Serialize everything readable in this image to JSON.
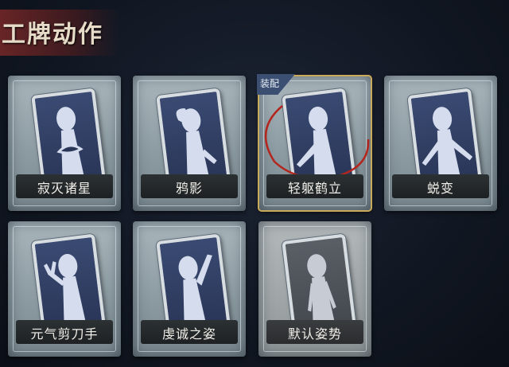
{
  "header": {
    "title": "工牌动作"
  },
  "cards": [
    {
      "label": "寂灭诸星",
      "pose": "hands-at-chest"
    },
    {
      "label": "鸦影",
      "pose": "hand-on-head"
    },
    {
      "label": "轻躯鹤立",
      "pose": "arm-sweep",
      "badge": "装配",
      "equipped": true
    },
    {
      "label": "蜕变",
      "pose": "arms-spread"
    },
    {
      "label": "元气剪刀手",
      "pose": "peace-sign"
    },
    {
      "label": "虔诚之姿",
      "pose": "arm-raised"
    },
    {
      "label": "默认姿势",
      "pose": "standing",
      "default": true
    }
  ],
  "colors": {
    "equipped_border": "#c9a95a",
    "ring": "#b3261e",
    "silhouette": "#d4dced"
  }
}
